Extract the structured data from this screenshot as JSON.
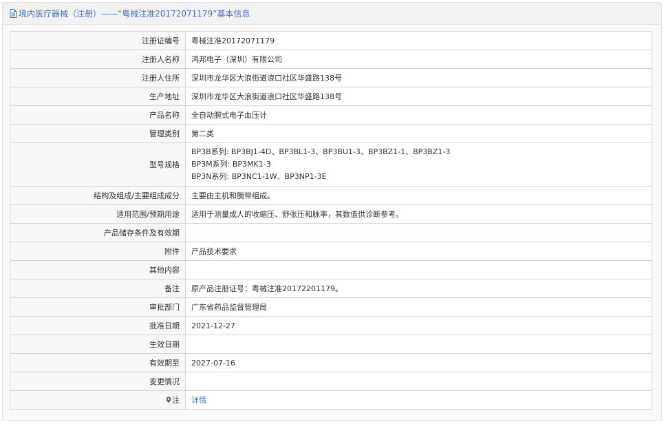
{
  "header": {
    "title": "境内医疗器械（注册）——“粤械注准20172071179”基本信息"
  },
  "rows": [
    {
      "label": "注册证编号",
      "value": "粤械注准20172071179"
    },
    {
      "label": "注册人名称",
      "value": "鸿邦电子（深圳）有限公司"
    },
    {
      "label": "注册人住所",
      "value": "深圳市龙华区大浪街道浪口社区华盛路138号"
    },
    {
      "label": "生产地址",
      "value": "深圳市龙华区大浪街道浪口社区华盛路138号"
    },
    {
      "label": "产品名称",
      "value": "全自动腕式电子血压计"
    },
    {
      "label": "管理类别",
      "value": "第二类"
    }
  ],
  "model_row": {
    "label": "型号规格",
    "lines": [
      "BP3B系列: BP3BJ1-4D、BP3BL1-3、BP3BU1-3、BP3BZ1-1、BP3BZ1-3",
      "BP3M系列: BP3MK1-3",
      "BP3N系列: BP3NC1-1W、BP3NP1-3E"
    ]
  },
  "rows2": [
    {
      "label": "结构及组成/主要组成成分",
      "value": "主要由主机和腕带组成。"
    },
    {
      "label": "适用范围/预期用途",
      "value": "适用于测量成人的收缩压、舒张压和脉率，其数值供诊断参考。"
    },
    {
      "label": "产品储存条件及有效期",
      "value": ""
    },
    {
      "label": "附件",
      "value": "产品技术要求"
    },
    {
      "label": "其他内容",
      "value": ""
    },
    {
      "label": "备注",
      "value": "原产品注册证号：粤械注准20172201179。"
    },
    {
      "label": "审批部门",
      "value": "广东省药品监督管理局"
    },
    {
      "label": "批准日期",
      "value": "2021-12-27"
    },
    {
      "label": "生效日期",
      "value": ""
    },
    {
      "label": "有效期至",
      "value": "2027-07-16"
    },
    {
      "label": "变更情况",
      "value": ""
    }
  ],
  "note_row": {
    "label": "注",
    "link_text": "详情"
  },
  "colors": {
    "header_text": "#4b73b5",
    "link": "#3a76c7",
    "label_bg": "#f7f7f7",
    "border": "#d4d4d4"
  },
  "icons": {
    "header": "document-icon",
    "note": "map-pin-icon"
  }
}
